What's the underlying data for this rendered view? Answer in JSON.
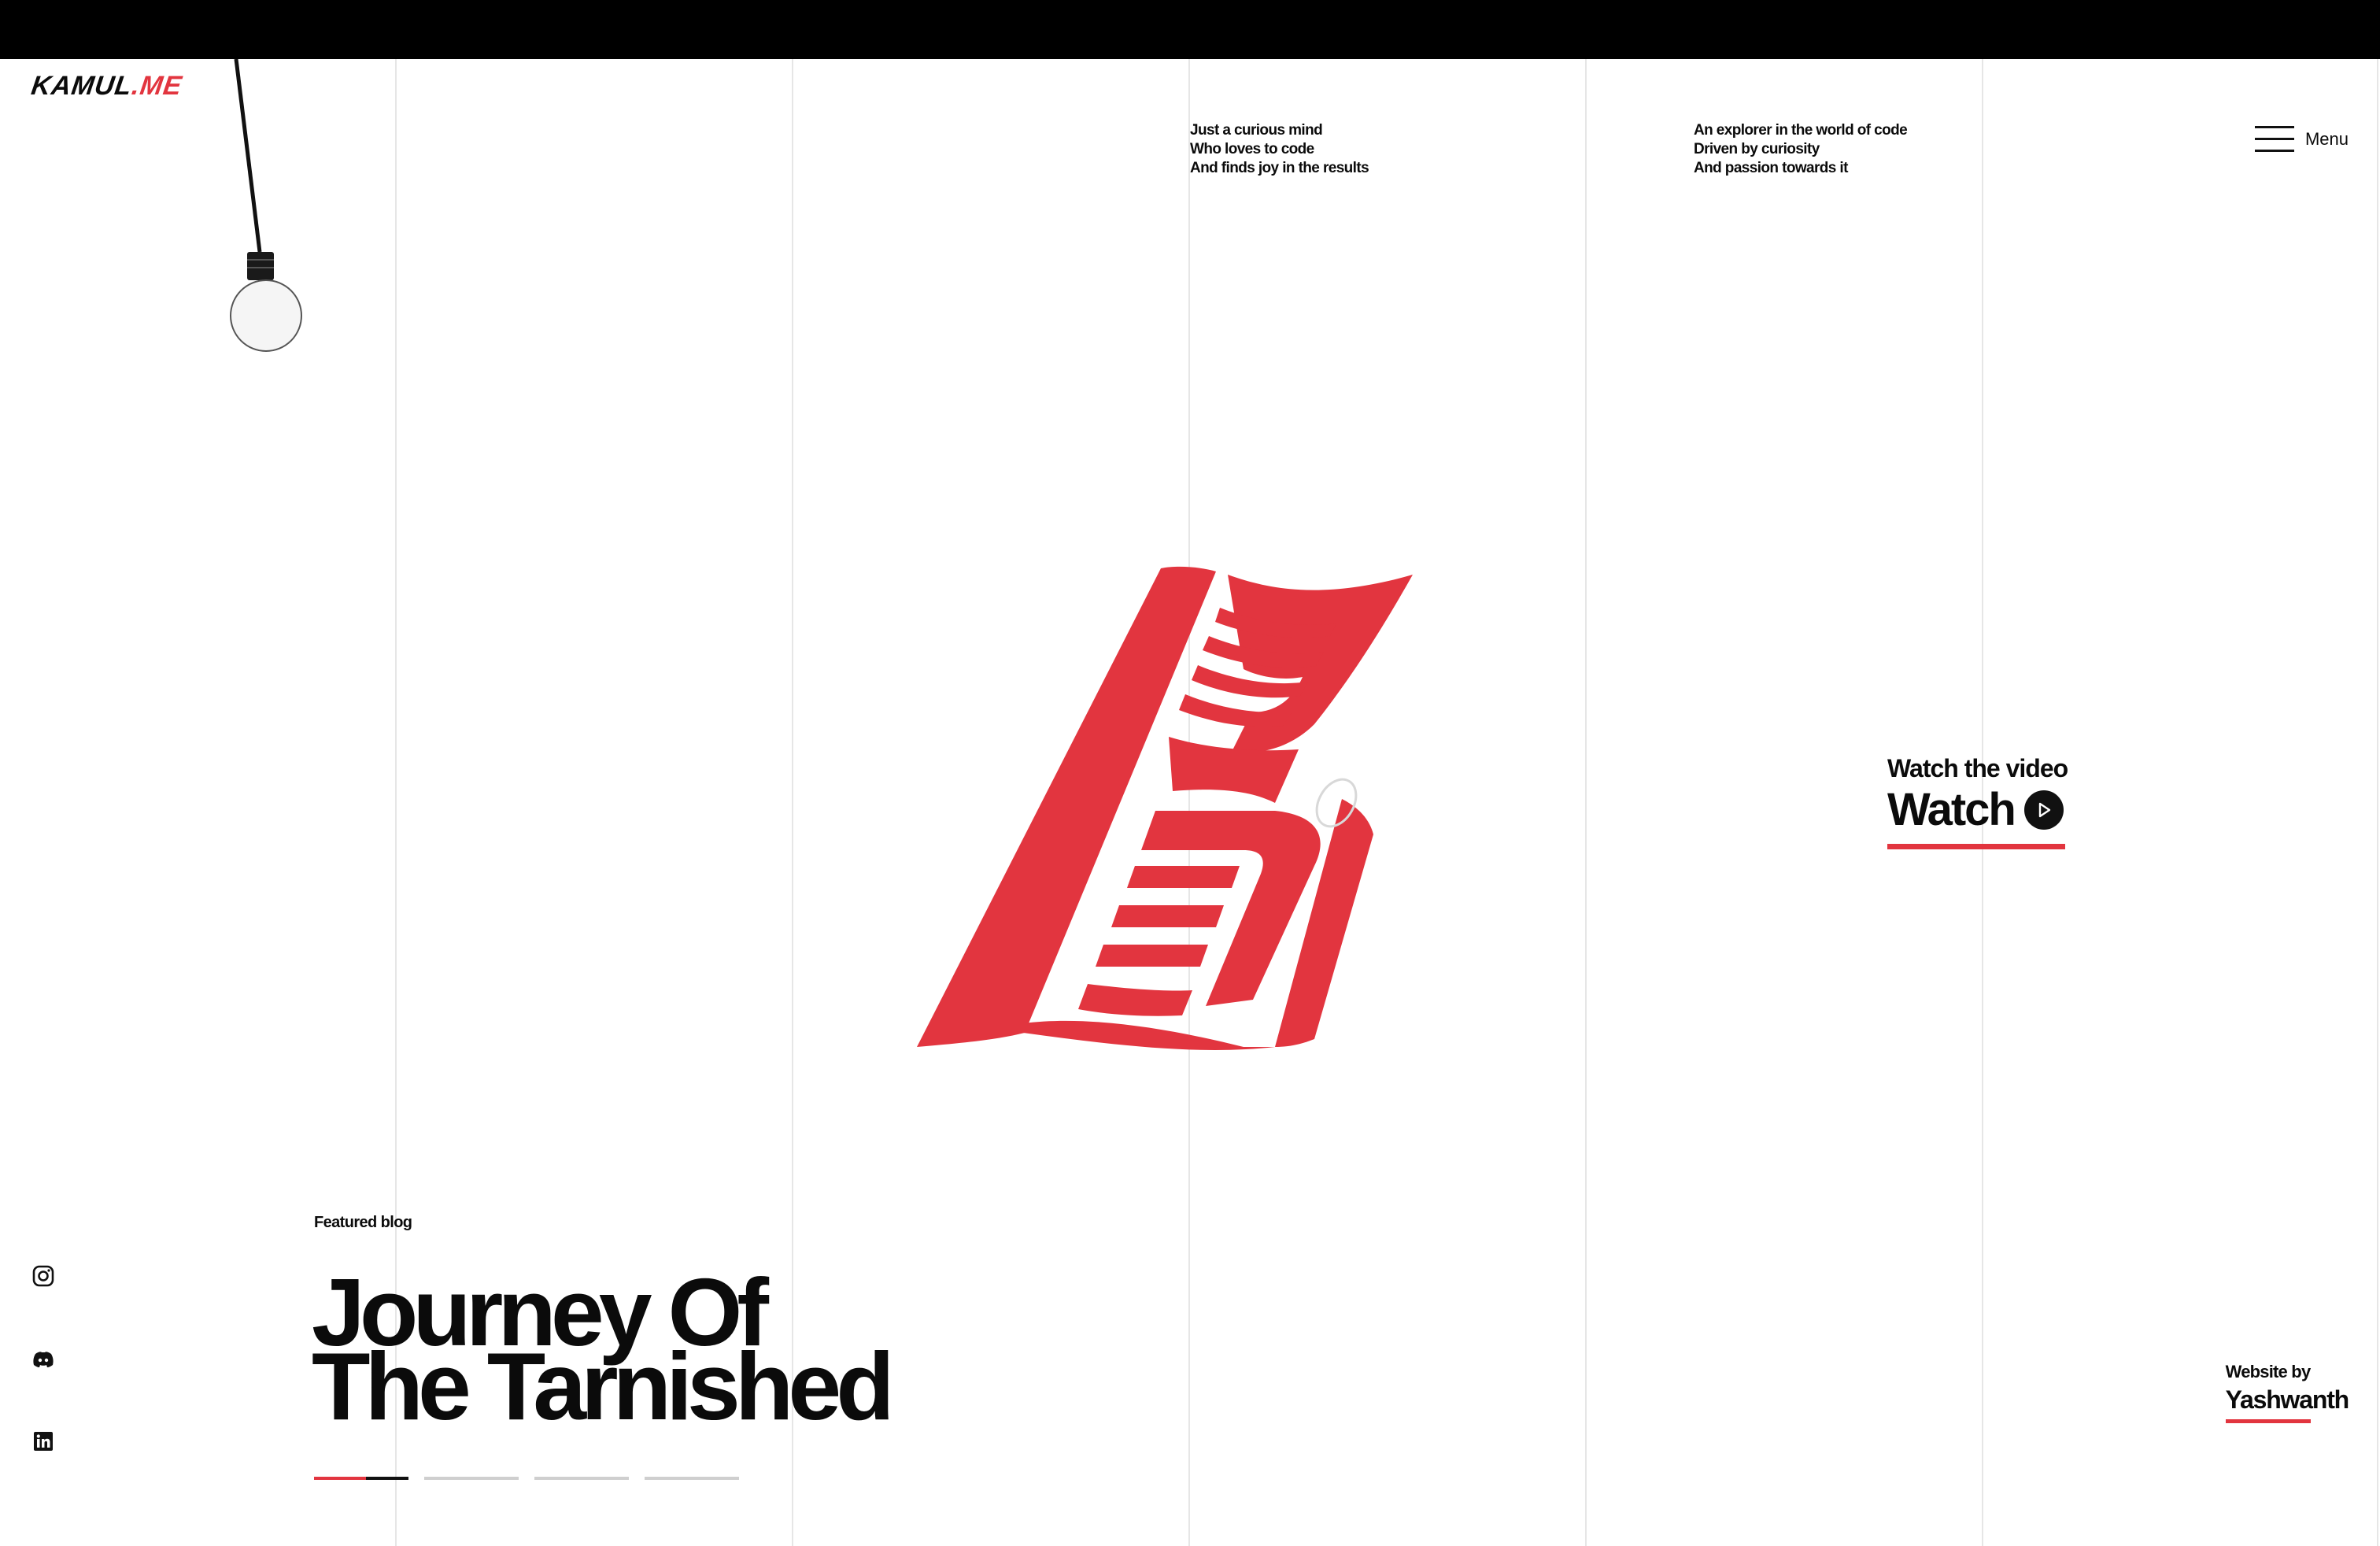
{
  "brand": {
    "logo_main": "KAMUL",
    "logo_accent": ".ME",
    "accent_color": "#e2353f"
  },
  "header": {
    "tagline_left": [
      "Just a curious mind",
      "Who loves to code",
      "And finds joy in the results"
    ],
    "tagline_right": [
      "An explorer in the world of code",
      "Driven by curiosity",
      "And passion towards it"
    ],
    "menu_label": "Menu"
  },
  "watch": {
    "small_label": "Watch the video",
    "big_label": "Watch",
    "icon": "play-icon"
  },
  "featured": {
    "label": "Featured blog",
    "title_line1": "Journey Of",
    "title_line2": "The Tarnished",
    "slides_total": 4,
    "active_slide": 1,
    "active_progress": 0.55
  },
  "socials": [
    {
      "icon": "instagram-icon"
    },
    {
      "icon": "discord-icon"
    },
    {
      "icon": "linkedin-icon"
    }
  ],
  "credit": {
    "label": "Website by",
    "name": "Yashwanth"
  },
  "decor": {
    "pendulum_icon": "light-bulb-icon",
    "emblem_icon": "kamul-emblem-icon"
  }
}
